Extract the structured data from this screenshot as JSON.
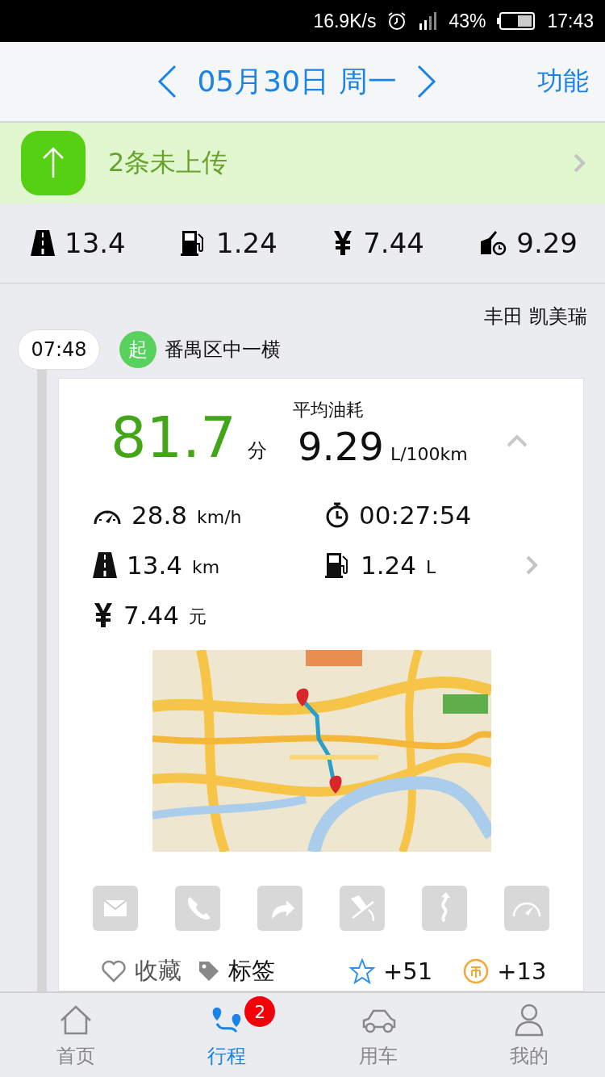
{
  "status_bar": {
    "network_speed": "16.9K/s",
    "battery": "43%",
    "time": "17:43"
  },
  "header": {
    "date": "05月30日 周一",
    "menu": "功能"
  },
  "upload_banner": {
    "text": "2条未上传"
  },
  "summary": [
    {
      "kind": "distance",
      "value": "13.4"
    },
    {
      "kind": "fuel",
      "value": "1.24"
    },
    {
      "kind": "cost",
      "value": "7.44"
    },
    {
      "kind": "consumption",
      "value": "9.29"
    }
  ],
  "trip": {
    "car": "丰田 凯美瑞",
    "start_time": "07:48",
    "start_badge": "起",
    "start_place": "番禺区中一横",
    "score": "81.7",
    "score_unit": "分",
    "avg_label": "平均油耗",
    "avg_value": "9.29",
    "avg_unit": "L/100km",
    "expanded": true,
    "stats": [
      {
        "kind": "speed",
        "value": "28.8",
        "unit": "km/h"
      },
      {
        "kind": "duration",
        "value": "00:27:54"
      },
      {
        "kind": "distance",
        "value": "13.4",
        "unit": "km"
      },
      {
        "kind": "fuel",
        "value": "1.24",
        "unit": "L"
      },
      {
        "kind": "cost",
        "value": "7.44",
        "unit": "元"
      }
    ],
    "actions": [
      {
        "kind": "mail"
      },
      {
        "kind": "phone"
      },
      {
        "kind": "turn"
      },
      {
        "kind": "brake"
      },
      {
        "kind": "curve"
      },
      {
        "kind": "speedometer"
      }
    ],
    "favorite": "收藏",
    "tags": "标签",
    "stars_points": "+51",
    "coins": "+13"
  },
  "tabs": [
    {
      "kind": "home",
      "label": "首页",
      "selected": false
    },
    {
      "kind": "trips",
      "label": "行程",
      "selected": true,
      "badge": "2"
    },
    {
      "kind": "car",
      "label": "用车",
      "selected": false
    },
    {
      "kind": "me",
      "label": "我的",
      "selected": false
    }
  ]
}
